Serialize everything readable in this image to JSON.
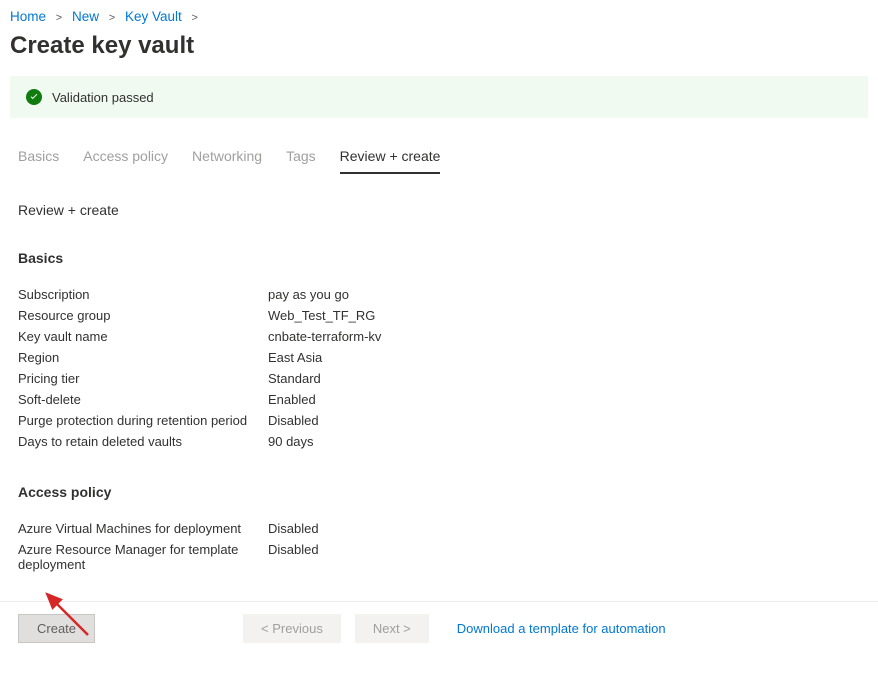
{
  "breadcrumb": {
    "items": [
      "Home",
      "New",
      "Key Vault"
    ]
  },
  "page_title": "Create key vault",
  "validation": {
    "message": "Validation passed"
  },
  "tabs": {
    "items": [
      {
        "label": "Basics",
        "active": false
      },
      {
        "label": "Access policy",
        "active": false
      },
      {
        "label": "Networking",
        "active": false
      },
      {
        "label": "Tags",
        "active": false
      },
      {
        "label": "Review + create",
        "active": true
      }
    ]
  },
  "current_section_title": "Review + create",
  "basics": {
    "heading": "Basics",
    "rows": [
      {
        "label": "Subscription",
        "value": "pay as you go"
      },
      {
        "label": "Resource group",
        "value": "Web_Test_TF_RG"
      },
      {
        "label": "Key vault name",
        "value": "cnbate-terraform-kv"
      },
      {
        "label": "Region",
        "value": "East Asia"
      },
      {
        "label": "Pricing tier",
        "value": "Standard"
      },
      {
        "label": "Soft-delete",
        "value": "Enabled"
      },
      {
        "label": "Purge protection during retention period",
        "value": "Disabled"
      },
      {
        "label": "Days to retain deleted vaults",
        "value": "90 days"
      }
    ]
  },
  "access_policy": {
    "heading": "Access policy",
    "rows": [
      {
        "label": "Azure Virtual Machines for deployment",
        "value": "Disabled"
      },
      {
        "label": "Azure Resource Manager for template deployment",
        "value": "Disabled"
      }
    ]
  },
  "footer": {
    "create": "Create",
    "previous": "< Previous",
    "next": "Next >",
    "download_link": "Download a template for automation"
  }
}
